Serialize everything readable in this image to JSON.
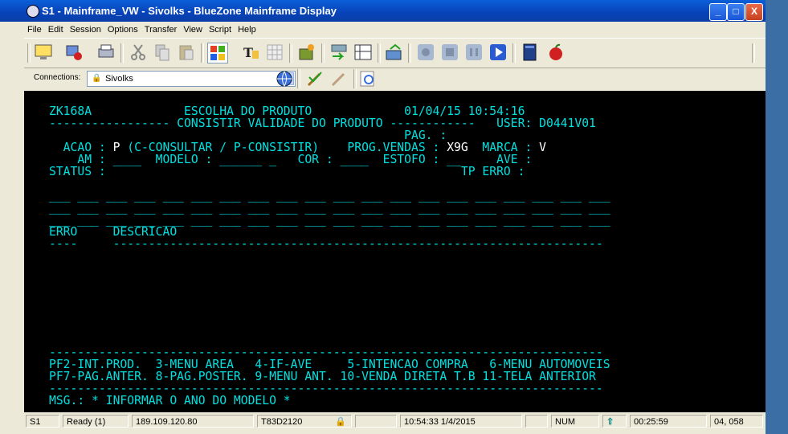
{
  "window": {
    "title": "S1 - Mainframe_VW - Sivolks - BlueZone Mainframe Display",
    "controls": [
      "_",
      "□",
      "X"
    ]
  },
  "menu": [
    "File",
    "Edit",
    "Session",
    "Options",
    "Transfer",
    "View",
    "Script",
    "Help"
  ],
  "toolbar": {
    "icons": [
      "monitor-icon",
      "disconnect-icon",
      "print-icon",
      "cut-icon",
      "copy-icon",
      "paste-icon",
      "windows-icon",
      "text-tool-icon",
      "grid-icon",
      "macro-icon",
      "transfer-send-icon",
      "column-icon",
      "export-icon",
      "record-icon",
      "stop-icon",
      "pause-icon",
      "play-icon",
      "book-icon",
      "apple-icon"
    ]
  },
  "connections": {
    "label": "Connections:",
    "selected": "Sivolks"
  },
  "terminal": {
    "lines": [
      [
        {
          "t": "ZK168A             ESCOLHA DO PRODUTO             01/04/15 10:54:16",
          "c": "cy"
        }
      ],
      [
        {
          "t": "----------------- CONSISTIR VALIDADE DO PRODUTO ------------   USER: D0441V01",
          "c": "cy"
        }
      ],
      [
        {
          "t": "                                                  PAG. :",
          "c": "cy"
        }
      ],
      [
        {
          "t": "  ACAO : ",
          "c": "cy"
        },
        {
          "t": "P",
          "c": "wh"
        },
        {
          "t": " (C-CONSULTAR / P-CONSISTIR)    PROG.VENDAS : ",
          "c": "cy"
        },
        {
          "t": "X9G",
          "c": "wh"
        },
        {
          "t": "  MARCA : ",
          "c": "cy"
        },
        {
          "t": "V",
          "c": "wh"
        }
      ],
      [
        {
          "t": "    AM : ____  MODELO : ______ _   COR : ____  ESTOFO : __     AVE :",
          "c": "cy"
        }
      ],
      [
        {
          "t": "STATUS :                                                  TP ERRO :",
          "c": "cy"
        }
      ],
      [
        {
          "t": "",
          "c": "cy"
        }
      ],
      [
        {
          "t": "___ ___ ___ ___ ___ ___ ___ ___ ___ ___ ___ ___ ___ ___ ___ ___ ___ ___ ___ ___",
          "c": "cy"
        }
      ],
      [
        {
          "t": "___ ___ ___ ___ ___ ___ ___ ___ ___ ___ ___ ___ ___ ___ ___ ___ ___ ___ ___ ___",
          "c": "cy"
        }
      ],
      [
        {
          "t": "___ ___ ___ ___ ___ ___ ___ ___ ___ ___ ___ ___ ___ ___ ___ ___ ___ ___ ___ ___",
          "c": "cy"
        }
      ],
      [
        {
          "t": "ERRO     DESCRICAO",
          "c": "cy"
        }
      ],
      [
        {
          "t": "----     ---------------------------------------------------------------------",
          "c": "cy"
        }
      ],
      [
        {
          "t": "",
          "c": "cy"
        }
      ],
      [
        {
          "t": "",
          "c": "cy"
        }
      ],
      [
        {
          "t": "",
          "c": "cy"
        }
      ],
      [
        {
          "t": "",
          "c": "cy"
        }
      ],
      [
        {
          "t": "",
          "c": "cy"
        }
      ],
      [
        {
          "t": "",
          "c": "cy"
        }
      ],
      [
        {
          "t": "",
          "c": "cy"
        }
      ],
      [
        {
          "t": "",
          "c": "cy"
        }
      ],
      [
        {
          "t": "------------------------------------------------------------------------------",
          "c": "cy"
        }
      ],
      [
        {
          "t": "PF2-INT.PROD.  3-MENU AREA   4-IF-AVE     5-INTENCAO COMPRA   6-MENU AUTOMOVEIS",
          "c": "cy"
        }
      ],
      [
        {
          "t": "PF7-PAG.ANTER. 8-PAG.POSTER. 9-MENU ANT. 10-VENDA DIRETA T.B 11-TELA ANTERIOR",
          "c": "cy"
        }
      ],
      [
        {
          "t": "------------------------------------------------------------------------------",
          "c": "cy"
        }
      ],
      [
        {
          "t": "MSG.: * INFORMAR O ANO DO MODELO *",
          "c": "cy"
        }
      ]
    ]
  },
  "status": {
    "session": "S1",
    "state": "Ready (1)",
    "ip": "189.109.120.80",
    "lu": "T83D2120",
    "lock_icon": "lock-icon",
    "datetime": "10:54:33  1/4/2015",
    "num": "NUM",
    "arrow_icon": "shift-up-icon",
    "elapsed": "00:25:59",
    "cursor": "04, 058"
  },
  "colors": {
    "terminal_bg": "#000000",
    "terminal_text": "#00e0e0",
    "input_text": "#ffffff",
    "titlebar": "#0a5fd8"
  }
}
